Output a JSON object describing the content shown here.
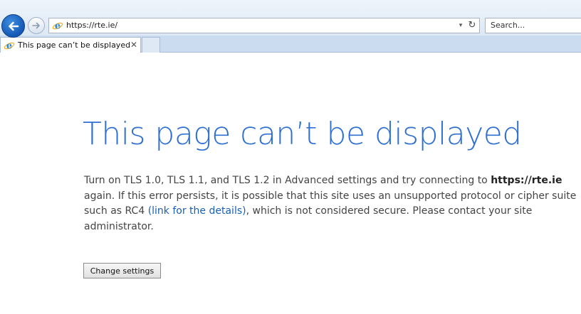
{
  "browser": {
    "address_url": "https://rte.ie/",
    "search_placeholder": "Search...",
    "tabs": [
      {
        "title": "This page can’t be displayed",
        "close_glyph": "✕",
        "active": true
      }
    ],
    "icons": {
      "back": "back-arrow-icon",
      "forward": "forward-arrow-icon",
      "site": "ie-logo-icon",
      "dropdown": "chevron-down-icon",
      "refresh": "refresh-icon"
    },
    "colors": {
      "back_button": "#1a5fc0",
      "chrome_background": "#dde8f5",
      "tab_strip": "#ccdcf0"
    }
  },
  "error": {
    "title": "This page can’t be displayed",
    "body_part1": "Turn on TLS 1.0, TLS 1.1, and TLS 1.2 in Advanced settings and try connecting to ",
    "host": "https://rte.ie",
    "body_part2": " again. If this error persists, it is possible that this site uses an unsupported protocol or cipher suite such as RC4 ",
    "link_text": "(link for the details)",
    "body_part3": ", which is not considered secure. Please contact your site administrator.",
    "button_label": "Change settings",
    "colors": {
      "title": "#2e6fd3",
      "body": "#444444",
      "link": "#1a5fb4"
    }
  }
}
